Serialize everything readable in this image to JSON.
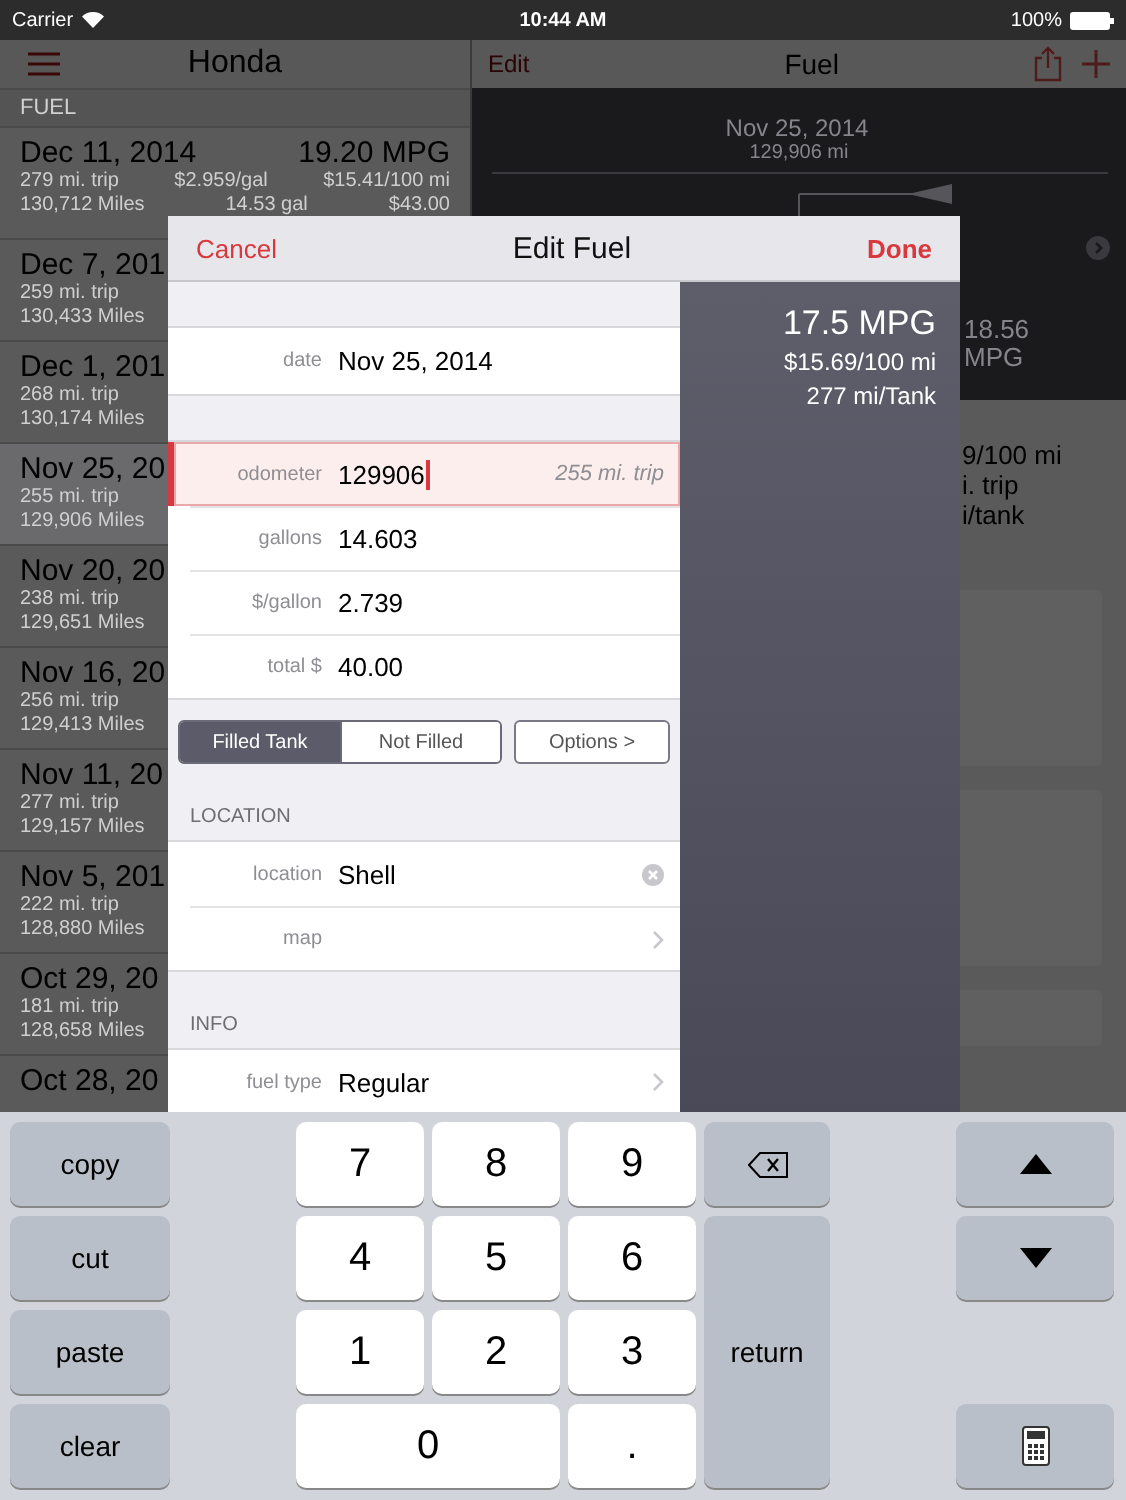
{
  "status_bar": {
    "carrier": "Carrier",
    "time": "10:44 AM",
    "battery": "100%"
  },
  "sidebar": {
    "title": "Honda",
    "section": "FUEL",
    "entries": [
      {
        "date": "Dec 11, 2014",
        "trip": "279 mi. trip",
        "odometer": "130,712 Miles",
        "price": "$2.959/gal",
        "gallons": "14.53 gal",
        "mpg": "19.20 MPG",
        "cost": "$15.41/100 mi",
        "total": "$43.00",
        "selected": false
      },
      {
        "date": "Dec 7, 201",
        "trip": "259 mi. trip",
        "odometer": "130,433 Miles",
        "selected": false
      },
      {
        "date": "Dec 1, 201",
        "trip": "268 mi. trip",
        "odometer": "130,174 Miles",
        "selected": false
      },
      {
        "date": "Nov 25, 20",
        "trip": "255 mi. trip",
        "odometer": "129,906 Miles",
        "selected": true
      },
      {
        "date": "Nov 20, 20",
        "trip": "238 mi. trip",
        "odometer": "129,651 Miles",
        "selected": false
      },
      {
        "date": "Nov 16, 20",
        "trip": "256 mi. trip",
        "odometer": "129,413 Miles",
        "selected": false
      },
      {
        "date": "Nov 11, 20",
        "trip": "277 mi. trip",
        "odometer": "129,157 Miles",
        "selected": false
      },
      {
        "date": "Nov 5, 201",
        "trip": "222 mi. trip",
        "odometer": "128,880 Miles",
        "selected": false
      },
      {
        "date": "Oct 29, 20",
        "trip": "181 mi. trip",
        "odometer": "128,658 Miles",
        "selected": false
      },
      {
        "date": "Oct 28, 20",
        "selected": false
      }
    ]
  },
  "detail": {
    "edit": "Edit",
    "title": "Fuel",
    "date": "Nov 25, 2014",
    "odometer": "129,906 mi",
    "mpg_value": "18.56",
    "mpg_unit": "MPG",
    "stats": [
      "9/100 mi",
      "i. trip",
      "i/tank"
    ]
  },
  "dialog": {
    "cancel": "Cancel",
    "title": "Edit Fuel",
    "done": "Done",
    "groups": [
      {
        "rows": [
          {
            "kind": "field",
            "label": "date",
            "value": "Nov 25, 2014",
            "focused": false
          }
        ]
      },
      {
        "rows": [
          {
            "kind": "field",
            "label": "odometer",
            "value": "129906",
            "hint": "255 mi. trip",
            "focused": true
          },
          {
            "kind": "field",
            "label": "gallons",
            "value": "14.603",
            "focused": false
          },
          {
            "kind": "field",
            "label": "$/gallon",
            "value": "2.739",
            "focused": false
          },
          {
            "kind": "field",
            "label": "total $",
            "value": "40.00",
            "focused": false
          }
        ]
      },
      {
        "segments": [
          {
            "label": "Filled Tank",
            "selected": true
          },
          {
            "label": "Not Filled",
            "selected": false
          }
        ],
        "options": "Options >"
      },
      {
        "header": "LOCATION",
        "rows": [
          {
            "kind": "clearable",
            "label": "location",
            "value": "Shell",
            "focused": false
          },
          {
            "kind": "disclosure",
            "label": "map",
            "focused": false
          }
        ]
      },
      {
        "header": "INFO",
        "rows": [
          {
            "kind": "disclosure",
            "label": "fuel type",
            "value": "Regular",
            "focused": false
          }
        ]
      }
    ],
    "summary": [
      "17.5 MPG",
      "$15.69/100 mi",
      "277 mi/Tank"
    ]
  },
  "keyboard": {
    "edit_keys": [
      "copy",
      "cut",
      "paste",
      "clear"
    ],
    "digits": [
      "7",
      "8",
      "9",
      "4",
      "5",
      "6",
      "1",
      "2",
      "3",
      "0",
      "."
    ],
    "return": "return"
  }
}
